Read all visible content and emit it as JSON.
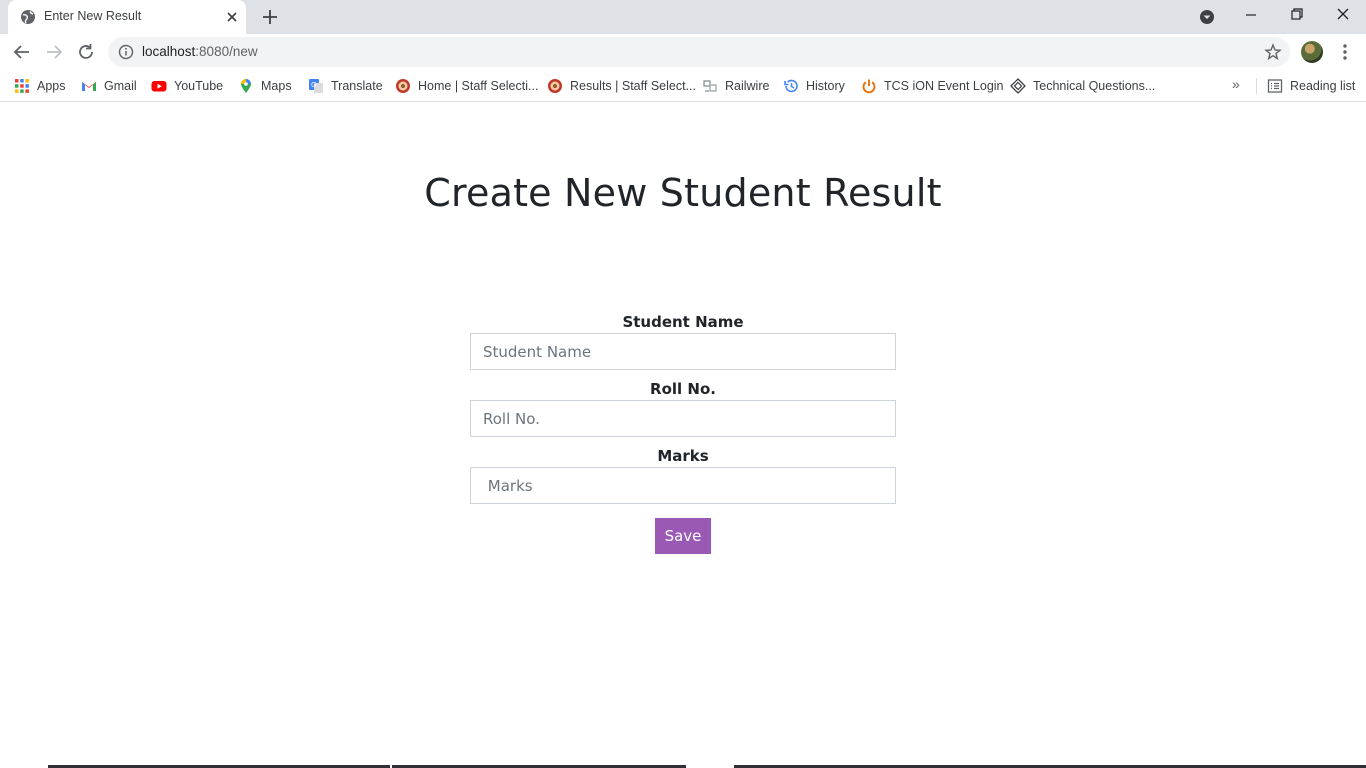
{
  "browser": {
    "tab_title": "Enter New Result",
    "url_host": "localhost",
    "url_path": ":8080/new",
    "bookmarks": [
      {
        "label": "Apps",
        "icon": "apps-grid-icon"
      },
      {
        "label": "Gmail",
        "icon": "gmail-icon"
      },
      {
        "label": "YouTube",
        "icon": "youtube-icon"
      },
      {
        "label": "Maps",
        "icon": "maps-icon"
      },
      {
        "label": "Translate",
        "icon": "translate-icon"
      },
      {
        "label": "Home | Staff Selecti...",
        "icon": "ssc-emblem-icon"
      },
      {
        "label": "Results | Staff Select...",
        "icon": "ssc-emblem-icon"
      },
      {
        "label": "Railwire",
        "icon": "railwire-icon"
      },
      {
        "label": "History",
        "icon": "history-icon"
      },
      {
        "label": "TCS iON Event Login",
        "icon": "power-icon"
      },
      {
        "label": "Technical Questions...",
        "icon": "diamond-icon"
      }
    ],
    "more_bookmarks": "»",
    "reading_list": "Reading list"
  },
  "page": {
    "title": "Create New Student Result",
    "fields": [
      {
        "label": "Student Name",
        "placeholder": "Student Name",
        "value": ""
      },
      {
        "label": "Roll No.",
        "placeholder": "Roll No.",
        "value": ""
      },
      {
        "label": "Marks",
        "placeholder": " Marks",
        "value": ""
      }
    ],
    "save_label": "Save"
  },
  "colors": {
    "accent": "#9b59b6",
    "tabstrip": "#dee1e6",
    "heading": "#212529"
  }
}
